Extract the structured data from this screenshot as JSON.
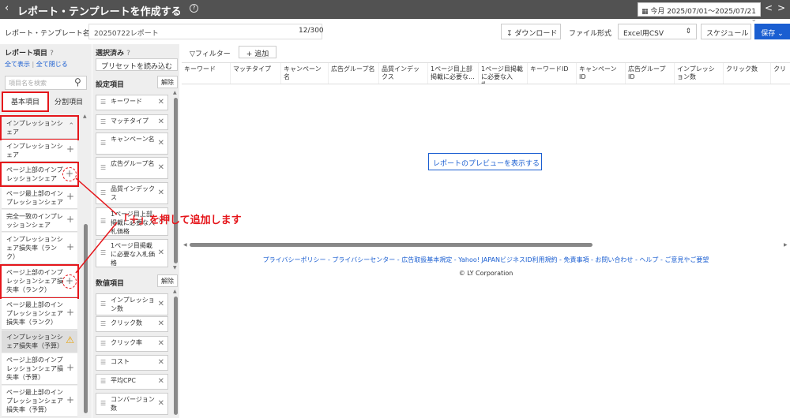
{
  "header": {
    "back_icon": "chevron-left-icon",
    "title": "レポート・テンプレートを作成する",
    "date_range": "今月 2025/07/01〜2025/07/21",
    "prev": "<",
    "next": ">"
  },
  "namebar": {
    "label": "レポート・テンプレート名",
    "value": "20250722レポート",
    "count": "12/300",
    "download": "ダウンロード",
    "file_format_label": "ファイル形式",
    "file_format_value": "Excel用CSV",
    "schedule": "スケジュール",
    "save": "保存"
  },
  "left": {
    "title": "レポート項目",
    "show_all": "全て表示",
    "close_all": "全て閉じる",
    "search_placeholder": "項目名を検索",
    "tab_basic": "基本項目",
    "tab_split": "分割項目",
    "items": [
      "インプレッションシェア",
      "インプレッションシェア",
      "ページ上部のインプレッションシェア",
      "ページ最上部のインプレッションシェア",
      "完全一致のインプレッションシェア",
      "インプレッションシェア損失率（ランク）",
      "ページ上部のインプレッションシェア損失率（ランク）",
      "ページ最上部のインプレッションシェア損失率（ランク）",
      "インプレッションシェア損失率（予算）",
      "ページ上部のインプレッションシェア損失率（予算）",
      "ページ最上部のインプレッションシェア損失率（予算）"
    ]
  },
  "middle": {
    "title": "選択済み",
    "load_preset": "プリセットを読み込む",
    "settings_label": "設定項目",
    "clear": "解除",
    "settings": [
      "キーワード",
      "マッチタイプ",
      "キャンペーン名",
      "広告グループ名",
      "品質インデックス",
      "1ページ目上部掲載に必要な入札価格",
      "1ページ目掲載に必要な入札価格"
    ],
    "metrics_label": "数値項目",
    "metrics": [
      "インプレッション数",
      "クリック数",
      "クリック率",
      "コスト",
      "平均CPC",
      "コンバージョン数"
    ]
  },
  "preview": {
    "filter": "フィルター",
    "add": "追加",
    "columns": [
      "キーワード",
      "マッチタイプ",
      "キャンペーン名",
      "広告グループ名",
      "品質インデックス",
      "1ページ目上部掲載に必要な...",
      "1ページ目掲載に必要な入札...",
      "キーワードID",
      "キャンペーンID",
      "広告グループID",
      "インプレッション数",
      "クリック数",
      "クリ"
    ],
    "show_preview": "レポートのプレビューを表示する"
  },
  "footer": {
    "links": "プライバシーポリシー - プライバシーセンター - 広告取扱基本規定 - Yahoo! JAPANビジネスID利用規約 - 免責事項 - お問い合わせ - ヘルプ - ご意見やご要望",
    "copyright": "© LY Corporation"
  },
  "annotation": "「＋」を押して追加します"
}
